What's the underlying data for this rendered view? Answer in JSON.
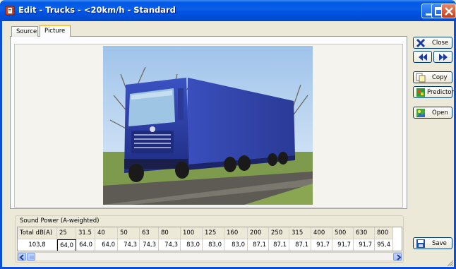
{
  "window": {
    "title": "Edit - Trucks - <20km/h - Standard",
    "controls": [
      "minimize-icon",
      "maximize-icon",
      "close-icon"
    ]
  },
  "tabs": [
    {
      "label": "Source",
      "active": false
    },
    {
      "label": "Picture",
      "active": true
    }
  ],
  "picture": {
    "subject": "blue truck photo",
    "icon": "truck-photo"
  },
  "buttons": {
    "close": {
      "label": "Close",
      "icon": "close-x-icon"
    },
    "prev": {
      "icon": "rewind-icon"
    },
    "next": {
      "icon": "fast-forward-icon"
    },
    "copy": {
      "label": "Copy",
      "icon": "copy-icon"
    },
    "predictor": {
      "label": "Predictor",
      "icon": "predictor-icon"
    },
    "open": {
      "label": "Open",
      "icon": "open-icon"
    },
    "save": {
      "label": "Save",
      "icon": "floppy-disk-icon"
    }
  },
  "sound_power": {
    "title": "Sound Power (A-weighted)",
    "headers": [
      "Total dB(A)",
      "25",
      "31.5",
      "40",
      "50",
      "63",
      "80",
      "100",
      "125",
      "160",
      "200",
      "250",
      "315",
      "400",
      "500",
      "630",
      "800"
    ],
    "values": [
      "103,8",
      "64,0",
      "64,0",
      "64,0",
      "74,3",
      "74,3",
      "74,3",
      "83,0",
      "83,0",
      "83,0",
      "87,1",
      "87,1",
      "87,1",
      "91,7",
      "91,7",
      "91,7",
      "95,4"
    ],
    "selected_index": 1
  },
  "colors": {
    "titlebar": "#0054e3",
    "truck_blue": "#2b3fa0",
    "sky": "#c9dff4"
  }
}
